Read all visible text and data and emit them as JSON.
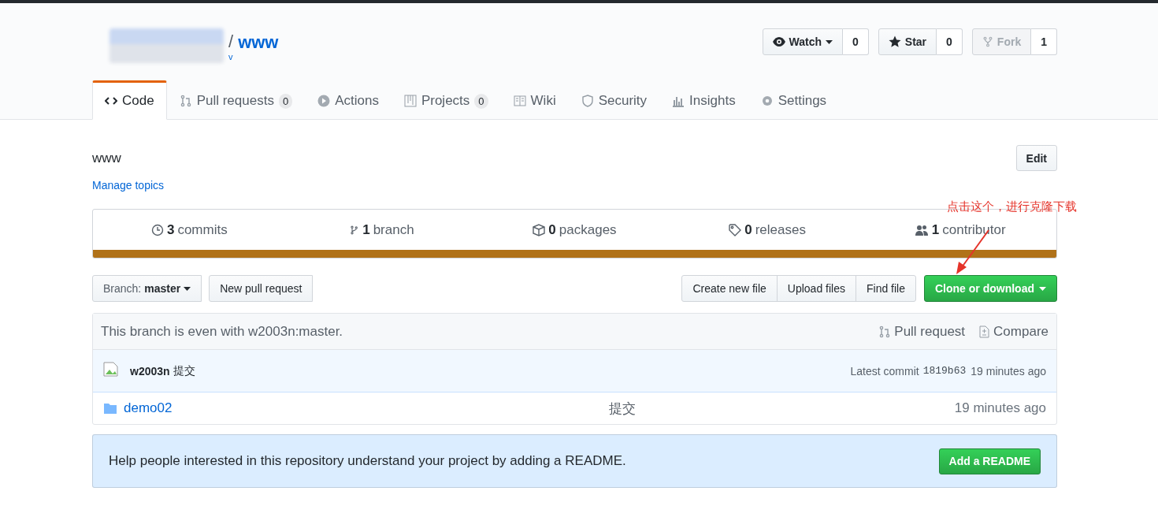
{
  "repo": {
    "separator": "/",
    "name": "www",
    "fork_note": "v"
  },
  "header_buttons": [
    {
      "kind": "watch",
      "label": "Watch",
      "count": "0",
      "disabled": false
    },
    {
      "kind": "star",
      "label": "Star",
      "count": "0",
      "disabled": false
    },
    {
      "kind": "fork",
      "label": "Fork",
      "count": "1",
      "disabled": true
    }
  ],
  "tabs": [
    {
      "kind": "code",
      "label": "Code",
      "selected": true
    },
    {
      "kind": "pr",
      "label": "Pull requests",
      "counter": "0",
      "selected": false
    },
    {
      "kind": "actions",
      "label": "Actions",
      "selected": false
    },
    {
      "kind": "projects",
      "label": "Projects",
      "counter": "0",
      "selected": false
    },
    {
      "kind": "wiki",
      "label": "Wiki",
      "selected": false
    },
    {
      "kind": "security",
      "label": "Security",
      "selected": false
    },
    {
      "kind": "insights",
      "label": "Insights",
      "selected": false
    },
    {
      "kind": "settings",
      "label": "Settings",
      "selected": false
    }
  ],
  "description": "www",
  "edit_button": "Edit",
  "manage_topics": "Manage topics",
  "summary": [
    {
      "kind": "commits",
      "number": "3",
      "label": "commits"
    },
    {
      "kind": "branch",
      "number": "1",
      "label": "branch"
    },
    {
      "kind": "packages",
      "number": "0",
      "label": "packages"
    },
    {
      "kind": "releases",
      "number": "0",
      "label": "releases"
    },
    {
      "kind": "contributor",
      "number": "1",
      "label": "contributor"
    }
  ],
  "languages": [
    {
      "color": "#b07219"
    }
  ],
  "branch_select": {
    "label": "Branch:",
    "value": "master"
  },
  "new_pr_button": "New pull request",
  "file_buttons": [
    "Create new file",
    "Upload files",
    "Find file"
  ],
  "clone_button": "Clone or download",
  "annotation": "点击这个，进行克隆下载",
  "branch_status": {
    "text": "This branch is even with w2003n:master.",
    "pull_request": "Pull request",
    "compare": "Compare"
  },
  "latest_commit": {
    "author": "w2003n",
    "message": "提交",
    "label": "Latest commit",
    "sha": "1819b63",
    "age": "19 minutes ago"
  },
  "files": [
    {
      "kind": "folder",
      "name": "demo02",
      "message": "提交",
      "age": "19 minutes ago"
    }
  ],
  "readme_prompt": {
    "text": "Help people interested in this repository understand your project by adding a README.",
    "button": "Add a README"
  }
}
